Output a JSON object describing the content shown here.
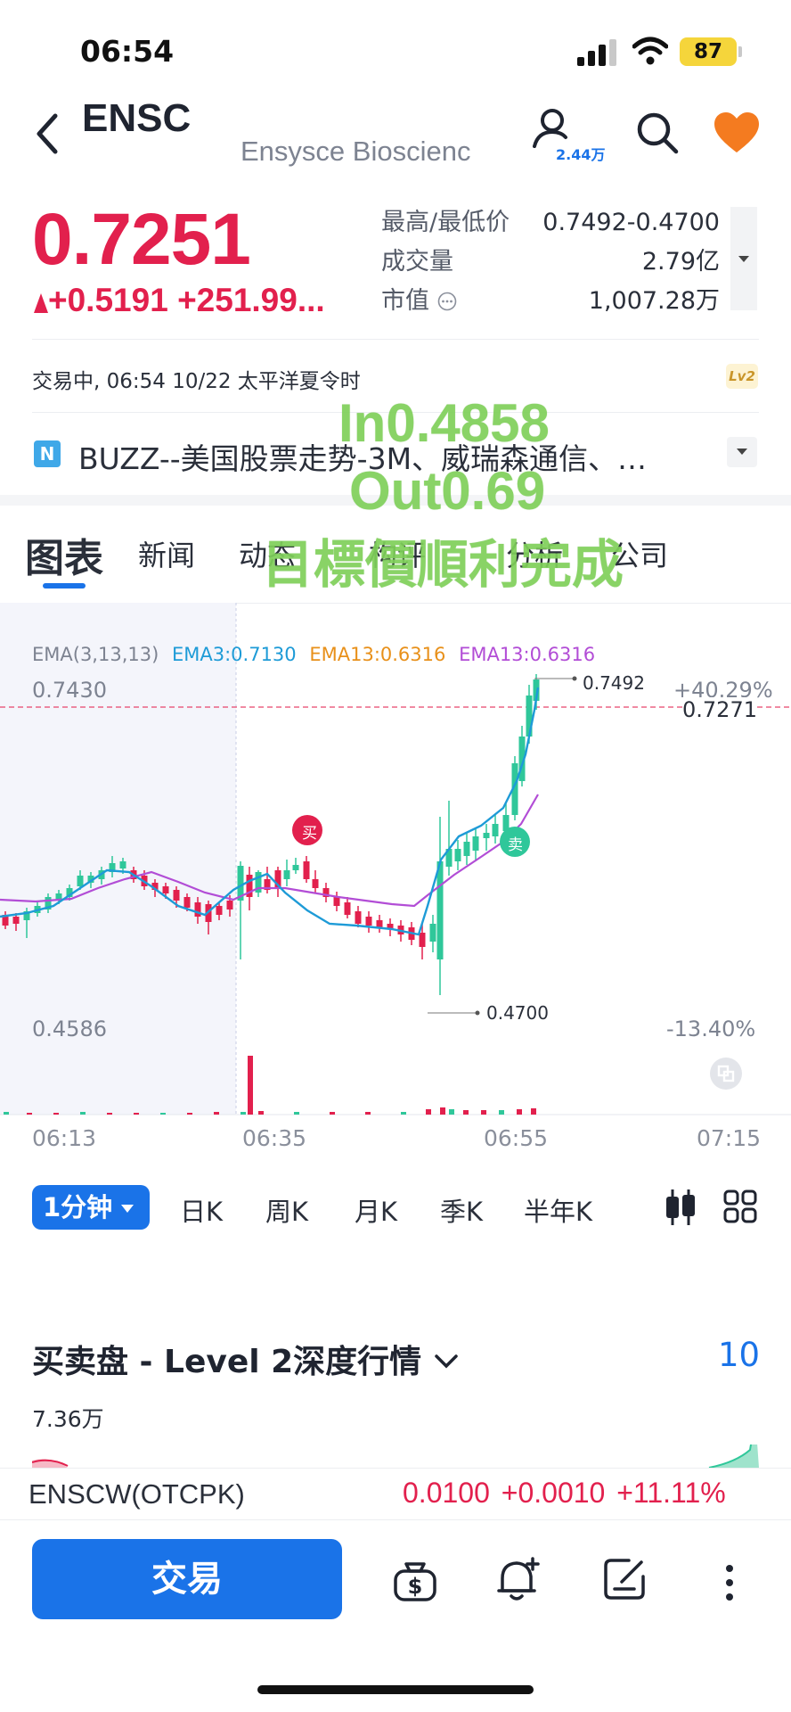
{
  "status_bar": {
    "time": "06:54",
    "battery": "87"
  },
  "header": {
    "ticker": "ENSC",
    "company_name": "Ensysce Bioscienc",
    "watchers": "2.44万"
  },
  "quote": {
    "price": "0.7251",
    "change": "+0.5191",
    "change_pct": "+251.99...",
    "stats": [
      {
        "label": "最高/最低价",
        "value": "0.7492-0.4700"
      },
      {
        "label": "成交量",
        "value": "2.79亿"
      },
      {
        "label": "市值",
        "value": "1,007.28万"
      }
    ]
  },
  "market_status": "交易中, 06:54 10/22 太平洋夏令时",
  "level_badge": "Lv2",
  "news": {
    "icon_letter": "N",
    "headline": "BUZZ--美国股票走势-3M、威瑞森通信、…"
  },
  "tabs": [
    "图表",
    "新闻",
    "动态",
    "构评",
    "分析",
    "公司"
  ],
  "overlay_text": {
    "line1": "In0.4858",
    "line2": "Out0.69",
    "line3": "目標價順利完成"
  },
  "chart": {
    "ema_legend": {
      "base": "EMA(3,13,13)",
      "ema3": "EMA3:0.7130",
      "ema13a": "EMA13:0.6316",
      "ema13b": "EMA13:0.6316"
    },
    "y_top_label": "0.7430",
    "y_bottom_label": "0.4586",
    "pct_top": "+40.29%",
    "pct_bottom": "-13.40%",
    "current_price_label": "0.7271",
    "high_label": "0.7492",
    "low_label": "0.4700",
    "buy_marker": "买",
    "sell_marker": "卖",
    "x_labels": [
      "06:13",
      "06:35",
      "06:55",
      "07:15"
    ],
    "colors": {
      "up": "#2fc79a",
      "down": "#e2204d",
      "ema3": "#1e9bd7",
      "ema13": "#b24dd6"
    }
  },
  "chart_data": {
    "type": "line",
    "title": "",
    "x": [
      "06:13",
      "06:35",
      "06:55",
      "07:15"
    ],
    "series": [
      {
        "name": "EMA3:0.7130",
        "last": 0.713
      },
      {
        "name": "EMA13:0.6316",
        "last": 0.6316
      }
    ],
    "high": 0.7492,
    "low": 0.47,
    "current": 0.7271,
    "ylim": [
      0.4586,
      0.743
    ]
  },
  "periods": {
    "active": "1分钟",
    "items": [
      "日K",
      "周K",
      "月K",
      "季K",
      "半年K"
    ]
  },
  "depth": {
    "title": "买卖盘 - Level 2深度行情",
    "count": "10",
    "volume": "7.36万"
  },
  "related": {
    "name": "ENSCW(OTCPK)",
    "price": "0.0100",
    "change": "+0.0010",
    "change_pct": "+11.11%"
  },
  "bottom_bar": {
    "trade_label": "交易"
  }
}
